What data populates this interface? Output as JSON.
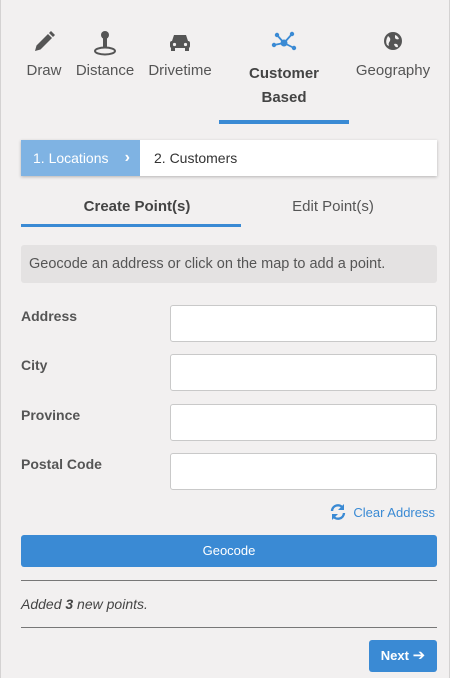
{
  "tabs": [
    {
      "label": "Draw",
      "icon": "pencil-icon"
    },
    {
      "label": "Distance",
      "icon": "location-pin-icon"
    },
    {
      "label": "Drivetime",
      "icon": "car-icon"
    },
    {
      "label_line1": "Customer",
      "label_line2": "Based",
      "icon": "network-icon",
      "active": true
    },
    {
      "label": "Geography",
      "icon": "globe-icon"
    }
  ],
  "steps": {
    "step1": "1. Locations",
    "step2": "2. Customers"
  },
  "subtabs": {
    "create": "Create Point(s)",
    "edit": "Edit Point(s)"
  },
  "hint": "Geocode an address or click on the map to add a point.",
  "form": {
    "address_label": "Address",
    "city_label": "City",
    "province_label": "Province",
    "postal_label": "Postal Code",
    "address_value": "",
    "city_value": "",
    "province_value": "",
    "postal_value": ""
  },
  "clear_address": "Clear Address",
  "geocode_button": "Geocode",
  "status": {
    "prefix": "Added ",
    "count": "3",
    "suffix": " new points."
  },
  "next_button": "Next",
  "colors": {
    "accent": "#3a8ad4",
    "step_active": "#7fb3e3",
    "background": "#f2f0f0"
  }
}
